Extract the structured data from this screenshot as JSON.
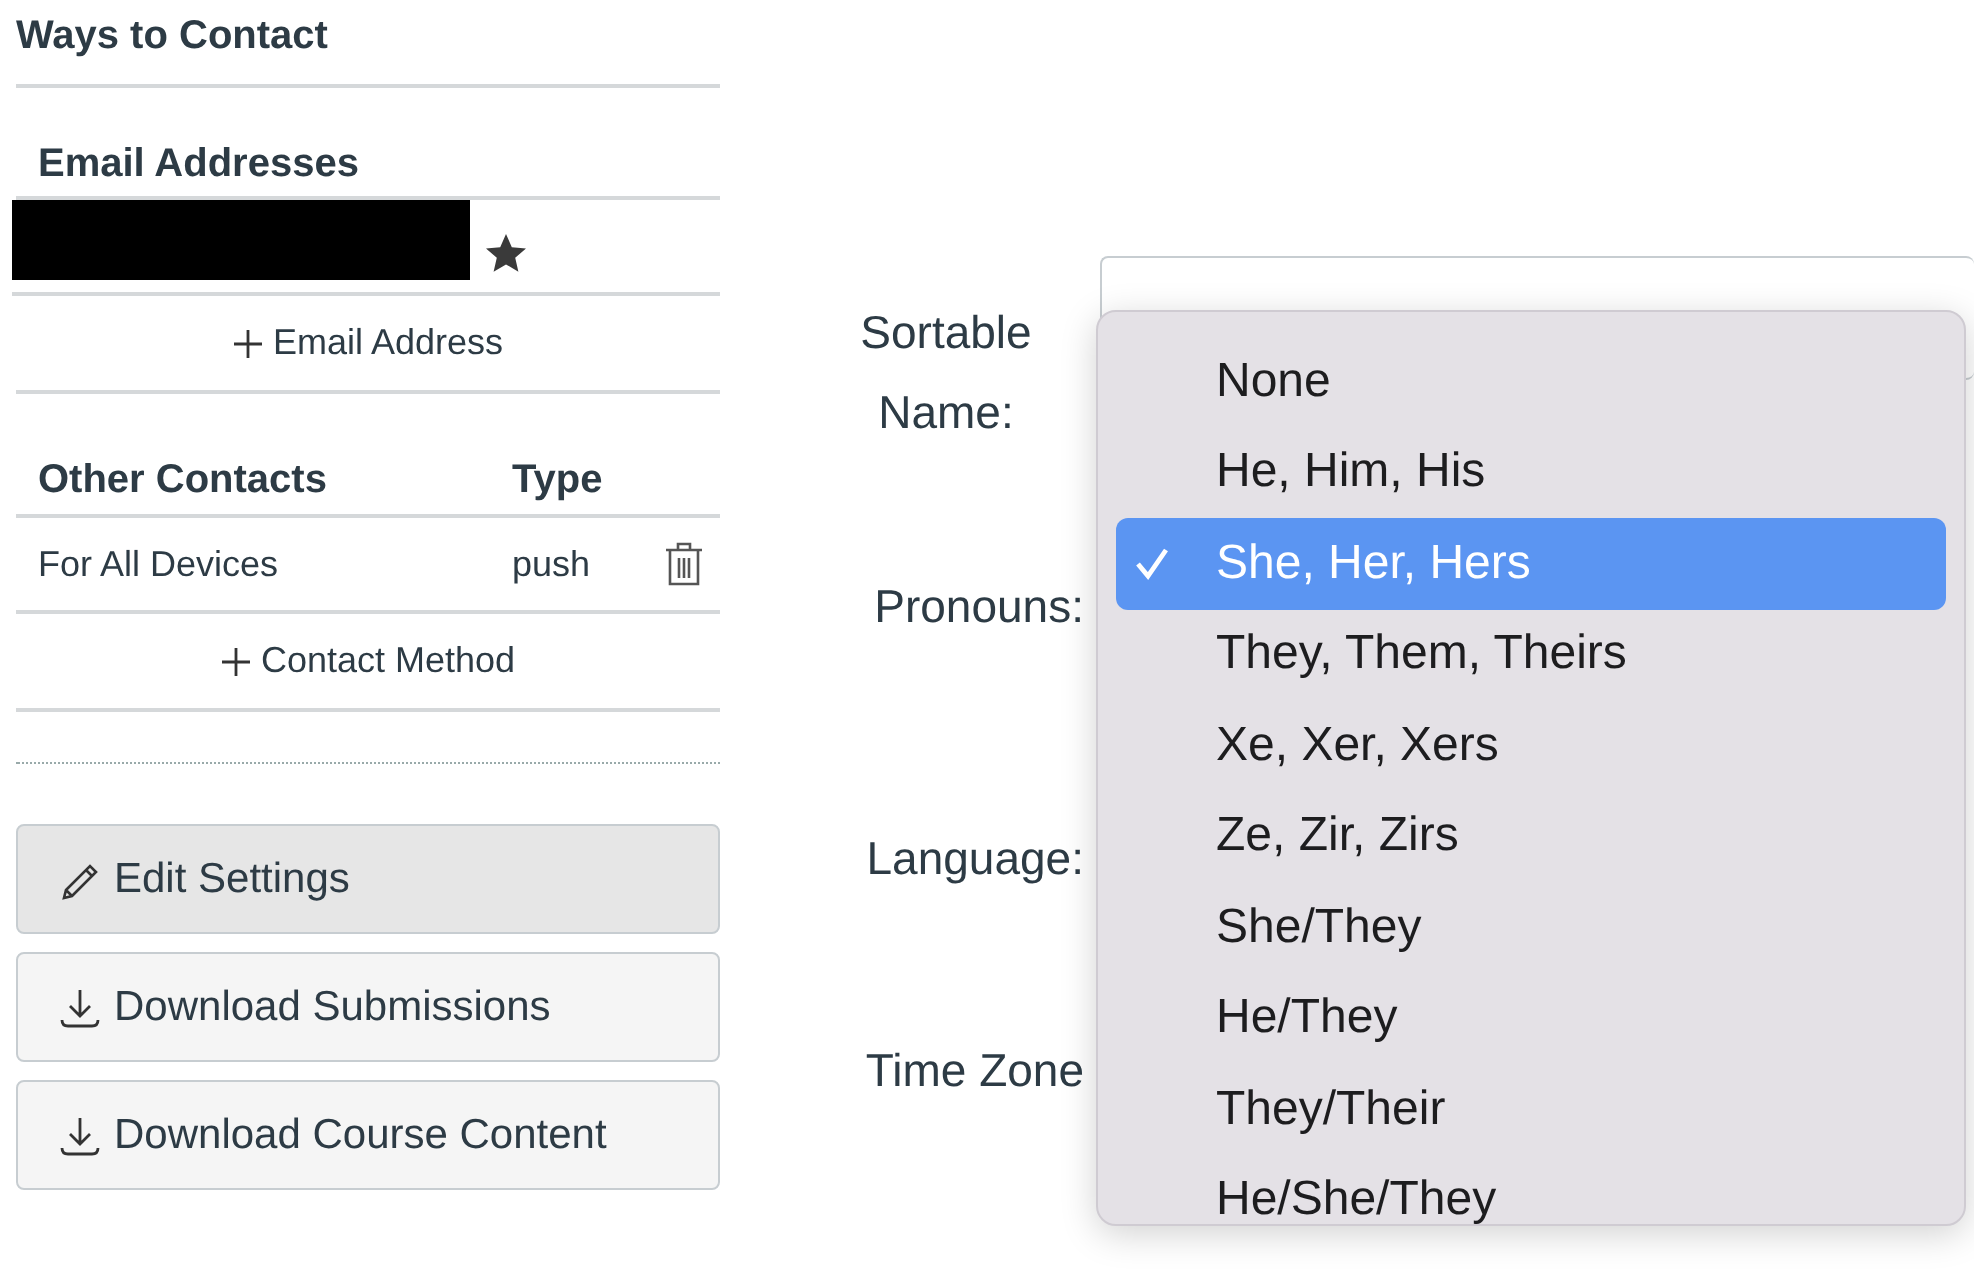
{
  "contact": {
    "title": "Ways to Contact",
    "email_header": "Email Addresses",
    "emails": [
      {
        "redacted": true,
        "default": true
      }
    ],
    "add_email": "Email Address",
    "other_header": "Other Contacts",
    "type_header": "Type",
    "other_contacts": [
      {
        "name": "For All Devices",
        "type": "push"
      }
    ],
    "add_contact": "Contact Method"
  },
  "actions": [
    {
      "label": "Edit Settings",
      "kind": "edit",
      "active": true
    },
    {
      "label": "Download Submissions",
      "kind": "download",
      "active": false
    },
    {
      "label": "Download Course Content",
      "kind": "download",
      "active": false
    }
  ],
  "form": {
    "labels": [
      "Sortable Name:",
      "Pronouns:",
      "Language:",
      "Time Zone"
    ]
  },
  "pronoun_menu": [
    {
      "label": "None",
      "selected": false
    },
    {
      "label": "He, Him, His",
      "selected": false
    },
    {
      "label": "She, Her, Hers",
      "selected": true
    },
    {
      "label": "They, Them, Theirs",
      "selected": false
    },
    {
      "label": "Xe, Xer, Xers",
      "selected": false
    },
    {
      "label": "Ze, Zir, Zirs",
      "selected": false
    },
    {
      "label": "She/They",
      "selected": false
    },
    {
      "label": "He/They",
      "selected": false
    },
    {
      "label": "They/Their",
      "selected": false
    },
    {
      "label": "He/She/They",
      "selected": false
    }
  ]
}
